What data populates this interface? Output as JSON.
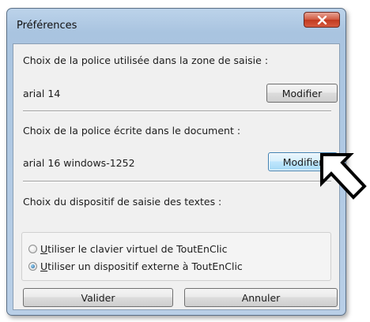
{
  "window": {
    "title": "Préférences",
    "close_icon": "close-icon"
  },
  "input_font": {
    "label": "Choix de la police utilisée dans la zone de saisie :",
    "value": "arial 14",
    "button_label": "Modifier"
  },
  "document_font": {
    "label": "Choix de la police écrite dans le document :",
    "value": "arial 16 windows-1252",
    "button_label": "Modifier"
  },
  "input_device": {
    "label": "Choix du dispositif de saisie des textes :",
    "options": [
      {
        "first_letter": "U",
        "rest": "tiliser le clavier virtuel de ToutEnClic",
        "checked": false
      },
      {
        "first_letter": "U",
        "rest": "tiliser un dispositif externe à ToutEnClic",
        "checked": true
      }
    ]
  },
  "footer": {
    "validate_label": "Valider",
    "cancel_label": "Annuler"
  },
  "annotation": {
    "icon": "pointer-arrow-icon"
  }
}
